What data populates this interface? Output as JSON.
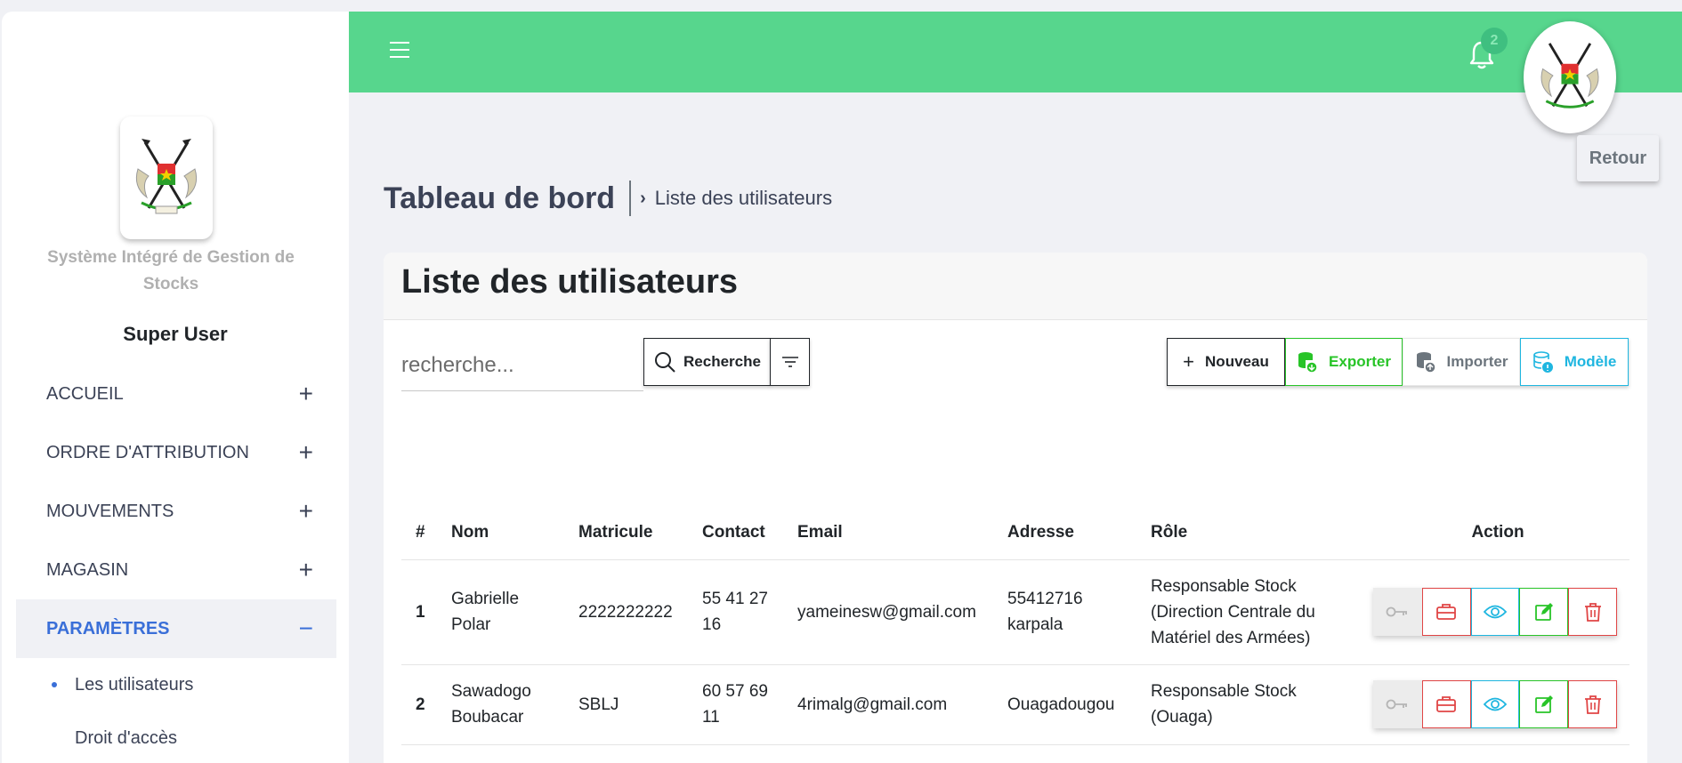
{
  "sidebar": {
    "app_name": "Système Intégré de Gestion de Stocks",
    "user": "Super User",
    "menu": [
      {
        "label": "ACCUEIL",
        "toggle": "+"
      },
      {
        "label": "ORDRE D'ATTRIBUTION",
        "toggle": "+"
      },
      {
        "label": "MOUVEMENTS",
        "toggle": "+"
      },
      {
        "label": "MAGASIN",
        "toggle": "+"
      },
      {
        "label": "PARAMÈTRES",
        "toggle": "−"
      }
    ],
    "submenu": [
      {
        "label": "Les utilisateurs"
      },
      {
        "label": "Droit d'accès"
      }
    ]
  },
  "topbar": {
    "notifications": "2",
    "back_label": "Retour"
  },
  "breadcrumb": {
    "title": "Tableau de bord",
    "current": "Liste des utilisateurs"
  },
  "card": {
    "title": "Liste des utilisateurs",
    "search_placeholder": "recherche...",
    "search_label": "Recherche",
    "buttons": {
      "nouveau": "Nouveau",
      "exporter": "Exporter",
      "importer": "Importer",
      "modele": "Modèle"
    }
  },
  "table": {
    "headers": [
      "#",
      "Nom",
      "Matricule",
      "Contact",
      "Email",
      "Adresse",
      "Rôle",
      "Action"
    ],
    "rows": [
      {
        "num": "1",
        "nom": "Gabrielle Polar",
        "matricule": "2222222222",
        "contact": "55 41 27 16",
        "email": "yameinesw@gmail.com",
        "adresse": "55412716 karpala",
        "role": "Responsable Stock (Direction Centrale du Matériel des Armées)"
      },
      {
        "num": "2",
        "nom": "Sawadogo Boubacar",
        "matricule": "SBLJ",
        "contact": "60 57 69 11",
        "email": "4rimalg@gmail.com",
        "adresse": "Ouagadougou",
        "role": "Responsable Stock (Ouaga)"
      }
    ]
  },
  "colors": {
    "topbar": "#57d68d",
    "accent": "#3a6fd8",
    "export": "#28c428",
    "model": "#1fb6e0",
    "danger": "#e04545"
  }
}
